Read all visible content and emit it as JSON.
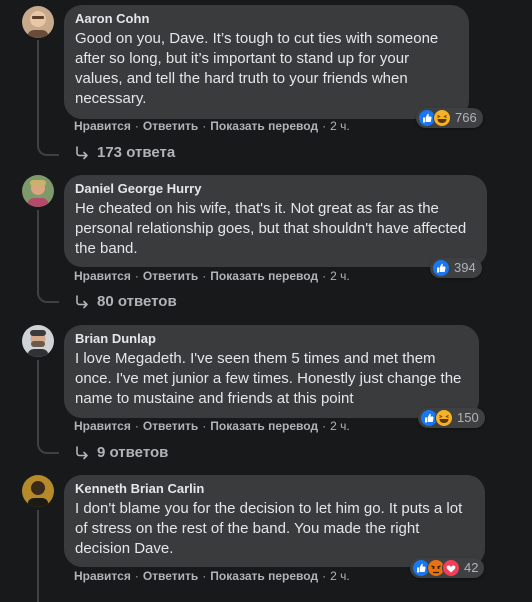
{
  "comments": [
    {
      "author": "Aaron Cohn",
      "text": "Good on you, Dave. It’s tough to cut ties with someone after so long, but it’s important to stand up for your values, and tell the hard truth to your friends when necessary.",
      "actions": {
        "like": "Нравится",
        "reply": "Ответить",
        "translate": "Показать перевод",
        "time": "2 ч."
      },
      "reactions": {
        "icons": [
          "like-icon",
          "haha-icon"
        ],
        "count": "766"
      },
      "replies_label": "173 ответа"
    },
    {
      "author": "Daniel George Hurry",
      "text": "He cheated on his wife, that's it. Not great as far as the personal relationship goes, but that shouldn't have affected the band.",
      "actions": {
        "like": "Нравится",
        "reply": "Ответить",
        "translate": "Показать перевод",
        "time": "2 ч."
      },
      "reactions": {
        "icons": [
          "like-icon"
        ],
        "count": "394"
      },
      "replies_label": "80 ответов"
    },
    {
      "author": "Brian Dunlap",
      "text": "I love Megadeth. I've seen them 5 times and met them once. I've met junior a few times. Honestly just change the name to mustaine and friends at this point",
      "actions": {
        "like": "Нравится",
        "reply": "Ответить",
        "translate": "Показать перевод",
        "time": "2 ч."
      },
      "reactions": {
        "icons": [
          "like-icon",
          "haha-icon"
        ],
        "count": "150"
      },
      "replies_label": "9 ответов"
    },
    {
      "author": "Kenneth Brian Carlin",
      "text": "I don't blame you for the decision to let him go. It puts a lot of stress on the rest of the band. You made the right decision Dave.",
      "actions": {
        "like": "Нравится",
        "reply": "Ответить",
        "translate": "Показать перевод",
        "time": "2 ч."
      },
      "reactions": {
        "icons": [
          "like-icon",
          "angry-icon",
          "love-icon"
        ],
        "count": "42"
      },
      "replies_label": ""
    }
  ],
  "colors": {
    "background": "#18191a",
    "bubble": "#3a3b3c",
    "text_primary": "#e4e6eb",
    "text_secondary": "#b0b3b8",
    "like_blue": "#1877f2",
    "love_red": "#f33e58",
    "haha_yellow": "#f7b125",
    "angry_orange": "#e9710f"
  }
}
